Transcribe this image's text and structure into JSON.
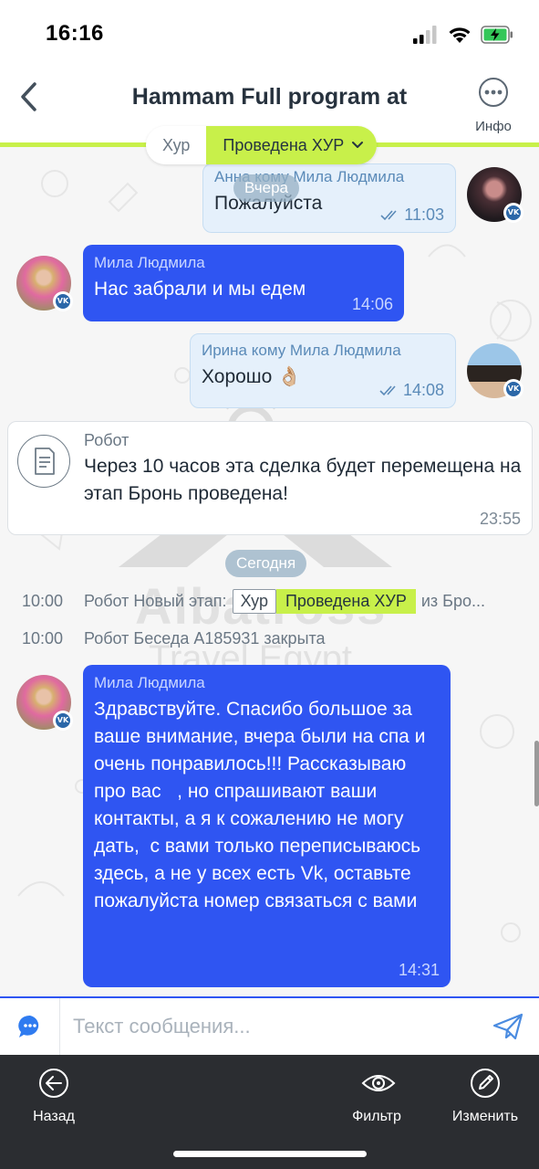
{
  "status_bar": {
    "time": "16:16"
  },
  "header": {
    "title": "Hammam Full program at",
    "info_label": "Инфо"
  },
  "stage": {
    "previous": "Хур",
    "current": "Проведена ХУР"
  },
  "messages": [
    {
      "sender": "Анна кому Мила Людмила",
      "text": "Пожалуйста",
      "time": "11:03"
    },
    {
      "sender": "Мила Людмила",
      "text": "Нас забрали и мы едем",
      "time": "14:06"
    },
    {
      "sender": "Ирина кому Мила Людмила",
      "text": "Хорошо 👌🏼",
      "time": "14:08"
    },
    {
      "sender": "Мила Людмила",
      "text": "Здравствуйте. Спасибо большое за ваше внимание, вчера были на спа и очень понравилось!!! Рассказываю про вас   , но спрашивают ваши контакты, а я к сожалению не могу дать,  с вами только переписываюсь здесь, а не у всех есть Vk, оставьте пожалуйста номер связаться с вами",
      "time": "14:31"
    }
  ],
  "date_separators": {
    "yesterday": "Вчера",
    "today": "Сегодня"
  },
  "robot_card": {
    "sender": "Робот",
    "text": "Через 10 часов эта сделка будет перемещена на этап Бронь проведена!",
    "time": "23:55"
  },
  "events": [
    {
      "time": "10:00",
      "prefix": "Робот Новый этап:",
      "from_stage": "Хур",
      "to_stage": "Проведена ХУР",
      "suffix": "из Бро..."
    },
    {
      "time": "10:00",
      "text": "Робот Беседа А185931 закрыта"
    }
  ],
  "composer": {
    "placeholder": "Текст сообщения..."
  },
  "bottom_bar": {
    "back_label": "Назад",
    "filter_label": "Фильтр",
    "edit_label": "Изменить"
  },
  "watermark": {
    "line1": "Albatross",
    "line2": "Travel Egypt"
  },
  "colors": {
    "accent_green": "#c8f04a",
    "incoming_bubble": "#2f55f2",
    "outgoing_bubble": "#e5f0fb",
    "bottom_bar": "#2b2d31"
  }
}
